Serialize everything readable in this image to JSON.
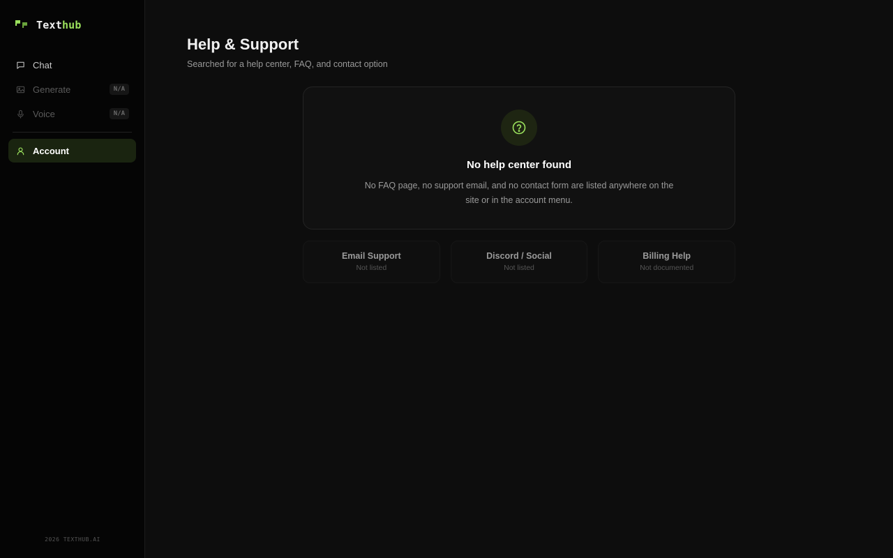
{
  "brand": {
    "name_part1": "Text",
    "name_part2": "hub",
    "accent": "#9be15d"
  },
  "sidebar": {
    "items": [
      {
        "label": "Chat",
        "icon": "chat-icon",
        "state": "enabled"
      },
      {
        "label": "Generate",
        "icon": "image-icon",
        "state": "disabled",
        "badge": "N/A"
      },
      {
        "label": "Voice",
        "icon": "microphone-icon",
        "state": "disabled",
        "badge": "N/A"
      },
      {
        "label": "Account",
        "icon": "user-icon",
        "state": "active"
      }
    ],
    "footer": "2026 TEXTHUB.AI"
  },
  "main": {
    "title": "Help & Support",
    "subtitle": "Searched for a help center, FAQ, and contact option",
    "empty_state": {
      "icon": "question-circle-icon",
      "title": "No help center found",
      "text": "No FAQ page, no support email, and no contact form are listed anywhere on the site or in the account menu."
    },
    "options": [
      {
        "title": "Email Support",
        "status": "Not listed"
      },
      {
        "title": "Discord / Social",
        "status": "Not listed"
      },
      {
        "title": "Billing Help",
        "status": "Not documented"
      }
    ]
  }
}
